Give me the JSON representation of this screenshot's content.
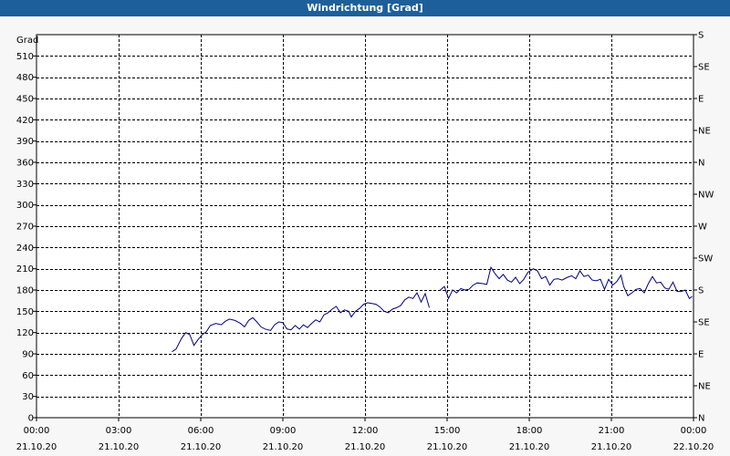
{
  "window": {
    "title": "Windrichtung [Grad]"
  },
  "chart_data": {
    "type": "line",
    "title": "Windrichtung [Grad]",
    "ylabel": "Grad",
    "ylim": [
      0,
      540
    ],
    "y_ticks": [
      0,
      30,
      60,
      90,
      120,
      150,
      180,
      210,
      240,
      270,
      300,
      330,
      360,
      390,
      420,
      450,
      480,
      510
    ],
    "y2_ticks": [
      {
        "value": 0,
        "label": "N"
      },
      {
        "value": 45,
        "label": "NE"
      },
      {
        "value": 90,
        "label": "E"
      },
      {
        "value": 135,
        "label": "SE"
      },
      {
        "value": 180,
        "label": "S"
      },
      {
        "value": 225,
        "label": "SW"
      },
      {
        "value": 270,
        "label": "W"
      },
      {
        "value": 315,
        "label": "NW"
      },
      {
        "value": 360,
        "label": "N"
      },
      {
        "value": 405,
        "label": "NE"
      },
      {
        "value": 450,
        "label": "E"
      },
      {
        "value": 495,
        "label": "SE"
      },
      {
        "value": 540,
        "label": "S"
      }
    ],
    "xlim": [
      0,
      24
    ],
    "x_ticks": [
      {
        "value": 0,
        "time": "00:00",
        "date": "21.10.20"
      },
      {
        "value": 3,
        "time": "03:00",
        "date": "21.10.20"
      },
      {
        "value": 6,
        "time": "06:00",
        "date": "21.10.20"
      },
      {
        "value": 9,
        "time": "09:00",
        "date": "21.10.20"
      },
      {
        "value": 12,
        "time": "12:00",
        "date": "21.10.20"
      },
      {
        "value": 15,
        "time": "15:00",
        "date": "21.10.20"
      },
      {
        "value": 18,
        "time": "18:00",
        "date": "21.10.20"
      },
      {
        "value": 21,
        "time": "21:00",
        "date": "21.10.20"
      },
      {
        "value": 24,
        "time": "00:00",
        "date": "22.10.20"
      }
    ],
    "grid": true,
    "colors": {
      "line": "#00007f",
      "grid": "#000000",
      "frame": "#000000"
    },
    "series": [
      {
        "values": [
          [
            [
              4.95,
              93
            ],
            [
              5.1,
              97
            ],
            [
              5.3,
              112
            ],
            [
              5.45,
              120
            ],
            [
              5.6,
              117
            ],
            [
              5.75,
              102
            ],
            [
              5.9,
              110
            ],
            [
              6.05,
              117
            ],
            [
              6.2,
              121
            ],
            [
              6.35,
              130
            ],
            [
              6.55,
              133
            ],
            [
              6.75,
              131
            ],
            [
              6.9,
              136
            ],
            [
              7.05,
              139
            ],
            [
              7.25,
              137
            ],
            [
              7.45,
              133
            ],
            [
              7.6,
              128
            ],
            [
              7.75,
              137
            ],
            [
              7.9,
              141
            ],
            [
              8.05,
              135
            ],
            [
              8.2,
              128
            ],
            [
              8.35,
              125
            ],
            [
              8.55,
              123
            ],
            [
              8.7,
              131
            ],
            [
              8.85,
              135
            ],
            [
              9.0,
              134
            ],
            [
              9.15,
              125
            ],
            [
              9.3,
              124
            ],
            [
              9.45,
              130
            ],
            [
              9.6,
              125
            ],
            [
              9.75,
              131
            ],
            [
              9.9,
              127
            ],
            [
              10.05,
              133
            ],
            [
              10.2,
              138
            ],
            [
              10.35,
              135
            ],
            [
              10.5,
              145
            ],
            [
              10.65,
              148
            ],
            [
              10.8,
              153
            ],
            [
              10.95,
              157
            ],
            [
              11.1,
              148
            ],
            [
              11.25,
              152
            ],
            [
              11.4,
              150
            ],
            [
              11.5,
              142
            ],
            [
              11.65,
              150
            ],
            [
              11.8,
              154
            ],
            [
              11.95,
              160
            ],
            [
              12.1,
              162
            ],
            [
              12.25,
              161
            ],
            [
              12.4,
              160
            ],
            [
              12.55,
              156
            ],
            [
              12.7,
              150
            ],
            [
              12.85,
              148
            ],
            [
              13.0,
              153
            ],
            [
              13.15,
              155
            ],
            [
              13.3,
              158
            ],
            [
              13.45,
              166
            ],
            [
              13.6,
              170
            ],
            [
              13.75,
              168
            ],
            [
              13.9,
              176
            ],
            [
              14.05,
              163
            ],
            [
              14.2,
              175
            ],
            [
              14.35,
              155
            ]
          ],
          [
            [
              14.75,
              180
            ],
            [
              14.9,
              185
            ],
            [
              15.05,
              168
            ],
            [
              15.2,
              180
            ],
            [
              15.35,
              176
            ],
            [
              15.5,
              182
            ],
            [
              15.65,
              180
            ],
            [
              15.8,
              181
            ],
            [
              15.95,
              187
            ],
            [
              16.1,
              190
            ],
            [
              16.3,
              189
            ],
            [
              16.45,
              188
            ],
            [
              16.6,
              212
            ],
            [
              16.75,
              203
            ],
            [
              16.9,
              196
            ],
            [
              17.05,
              202
            ],
            [
              17.2,
              194
            ],
            [
              17.35,
              191
            ],
            [
              17.5,
              198
            ],
            [
              17.65,
              189
            ],
            [
              17.8,
              195
            ],
            [
              17.95,
              205
            ],
            [
              18.15,
              210
            ],
            [
              18.3,
              207
            ],
            [
              18.45,
              196
            ],
            [
              18.6,
              199
            ],
            [
              18.75,
              187
            ],
            [
              18.9,
              195
            ],
            [
              19.05,
              196
            ],
            [
              19.2,
              194
            ],
            [
              19.4,
              198
            ],
            [
              19.55,
              200
            ],
            [
              19.7,
              196
            ],
            [
              19.85,
              207
            ],
            [
              20.0,
              199
            ],
            [
              20.15,
              201
            ],
            [
              20.3,
              194
            ],
            [
              20.45,
              193
            ],
            [
              20.6,
              195
            ],
            [
              20.75,
              181
            ],
            [
              20.9,
              195
            ],
            [
              21.05,
              187
            ],
            [
              21.2,
              192
            ],
            [
              21.35,
              201
            ],
            [
              21.45,
              185
            ],
            [
              21.6,
              172
            ],
            [
              21.75,
              176
            ],
            [
              21.9,
              181
            ],
            [
              22.05,
              182
            ],
            [
              22.2,
              176
            ],
            [
              22.35,
              189
            ],
            [
              22.5,
              199
            ],
            [
              22.65,
              190
            ],
            [
              22.8,
              191
            ],
            [
              22.95,
              183
            ],
            [
              23.1,
              181
            ],
            [
              23.25,
              191
            ],
            [
              23.4,
              178
            ],
            [
              23.55,
              178
            ],
            [
              23.7,
              180
            ],
            [
              23.85,
              168
            ],
            [
              23.95,
              171
            ]
          ]
        ]
      }
    ]
  }
}
